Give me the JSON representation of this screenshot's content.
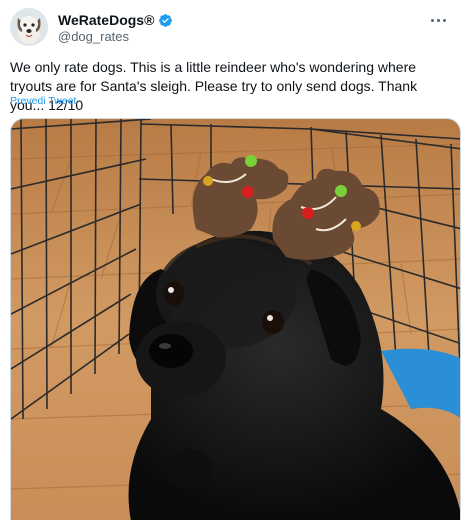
{
  "author": {
    "display_name": "WeRateDogs®",
    "handle": "@dog_rates",
    "verified": true,
    "avatar_icon": "dog-avatar-icon",
    "verified_icon": "verified-badge-icon",
    "verified_color": "#1d9bf0"
  },
  "tweet": {
    "text": "We only rate dogs. This is a little reindeer who's wondering where tryouts are for Santa's sleigh. Please try to only send dogs. Thank you... 12/10",
    "translate_label": "Prevedi Tweet"
  },
  "media": {
    "icon": "black-puppy-with-reindeer-antlers-photo"
  },
  "menu": {
    "icon": "more-options-icon"
  },
  "colors": {
    "accent": "#1d9bf0",
    "text": "#0f1419",
    "secondary_text": "#536471",
    "border": "#cfd9de"
  }
}
